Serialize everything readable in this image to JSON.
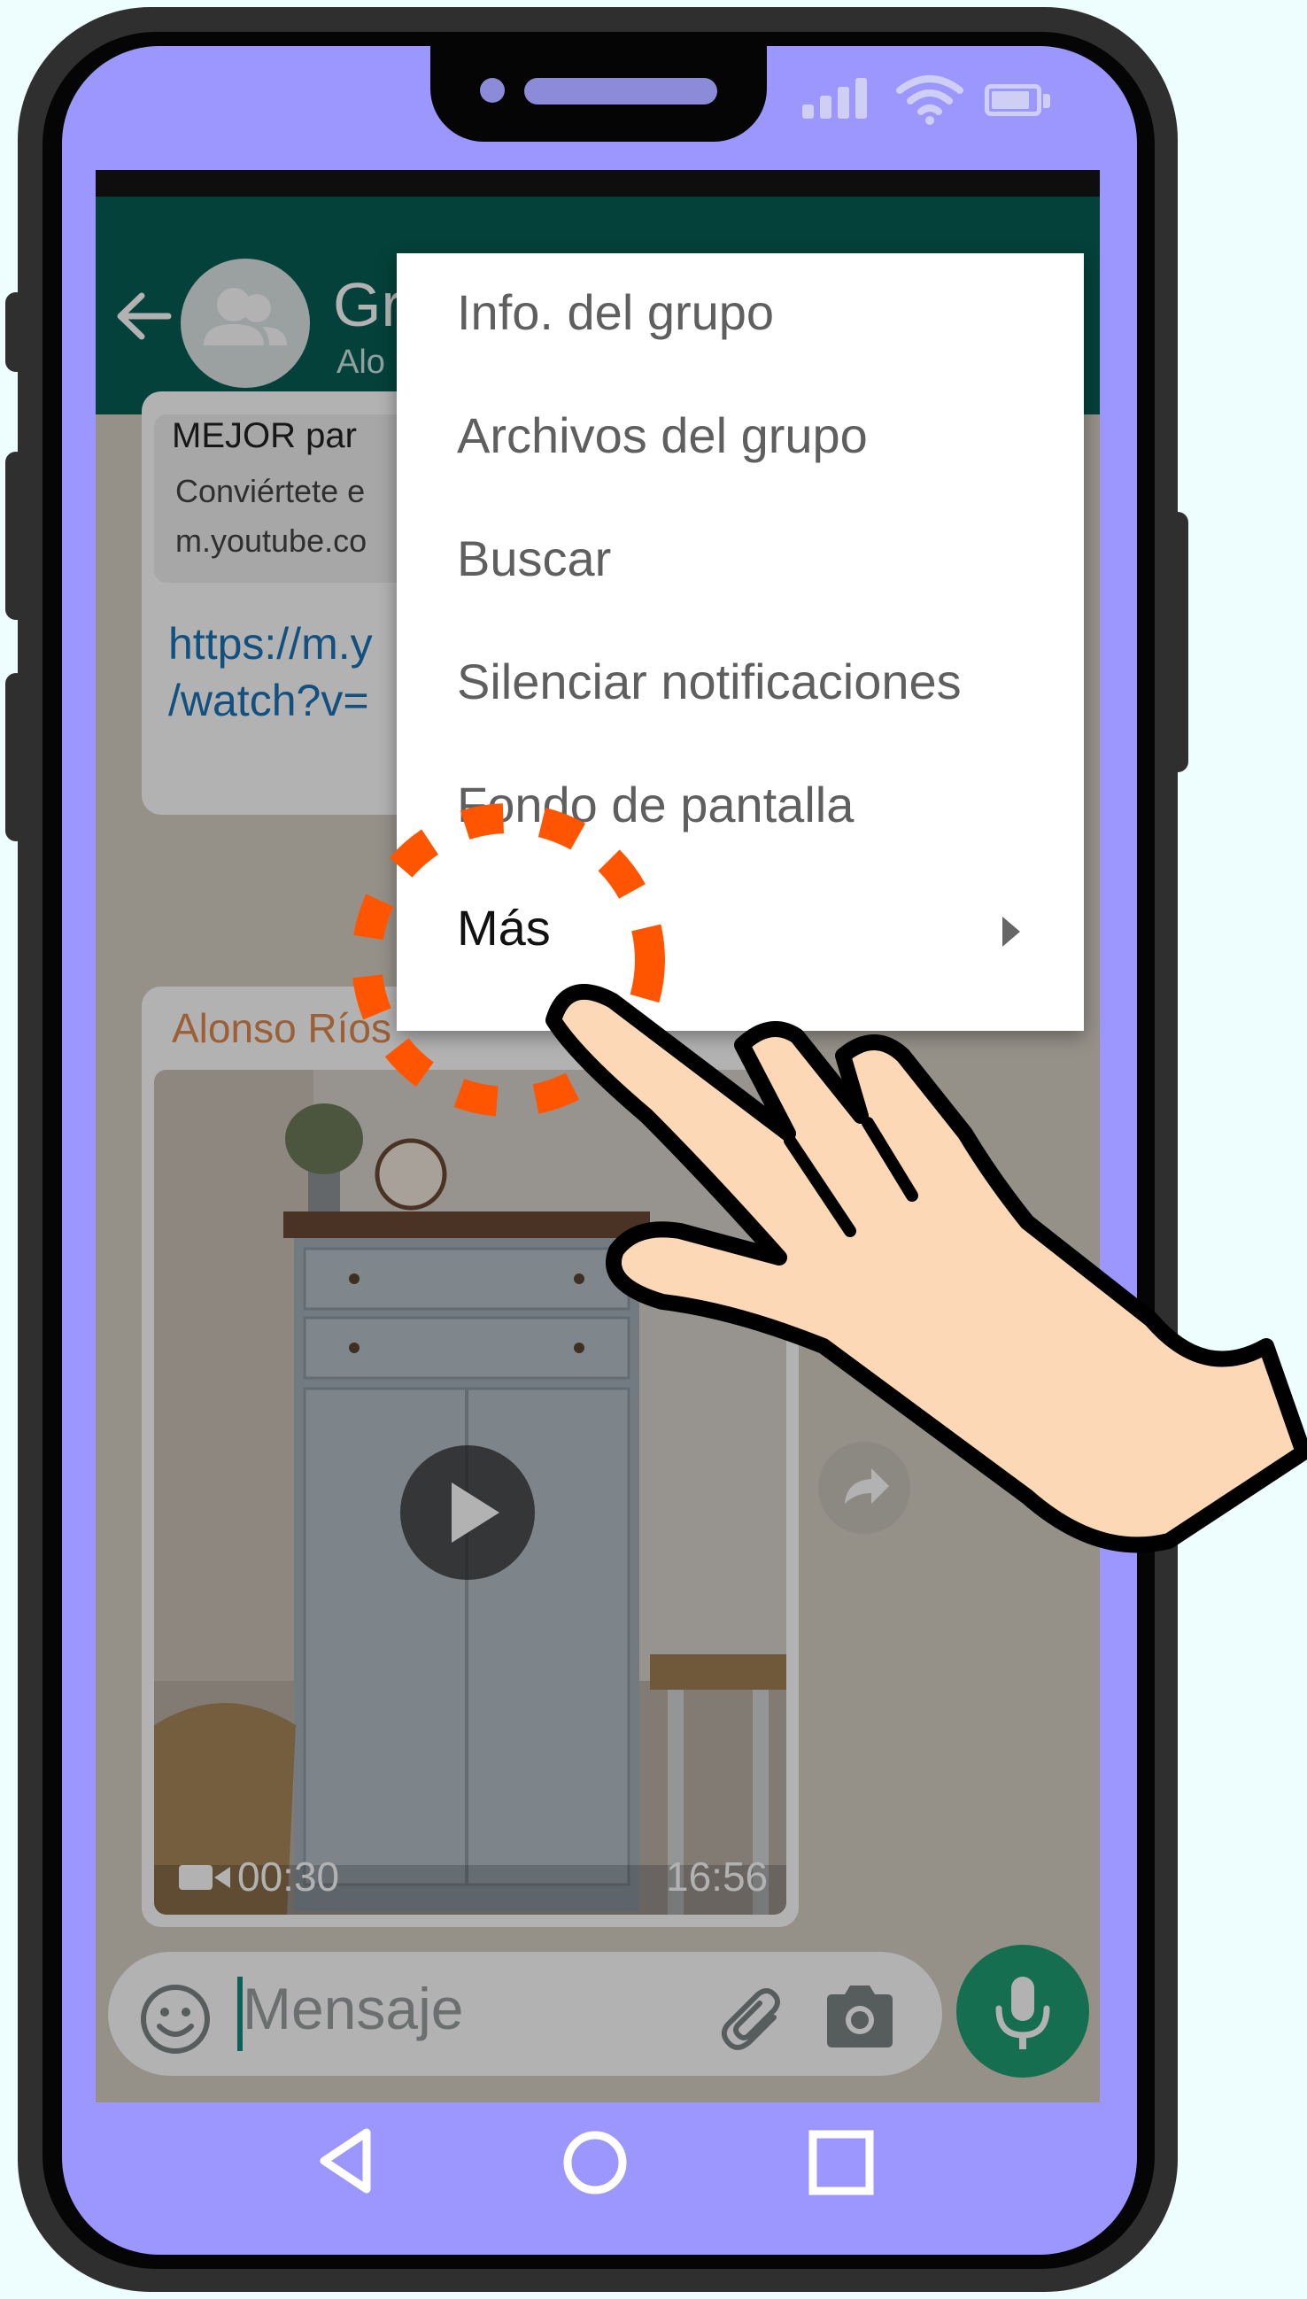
{
  "header": {
    "title": "Gr",
    "subtitle": "Alo"
  },
  "chat": {
    "link_preview": {
      "title": "MEJOR par",
      "line1": "Conviértete e",
      "line2": "m.youtube.co"
    },
    "link_text": {
      "line1": "https://m.y",
      "line2": "/watch?v="
    },
    "video_message": {
      "sender": "Alonso Ríos",
      "duration": "00:30",
      "time": "16:56"
    }
  },
  "composer": {
    "placeholder": "Mensaje"
  },
  "menu": {
    "items": [
      {
        "label": "Info. del grupo"
      },
      {
        "label": "Archivos del grupo"
      },
      {
        "label": "Buscar"
      },
      {
        "label": "Silenciar notificaciones"
      },
      {
        "label": "Fondo de pantalla"
      },
      {
        "label": "Más"
      }
    ]
  },
  "colors": {
    "app_bar": "#075e54",
    "phone_face": "#9b97ff",
    "highlight_ring": "#ff5500",
    "mic_button": "#1f9e72"
  }
}
